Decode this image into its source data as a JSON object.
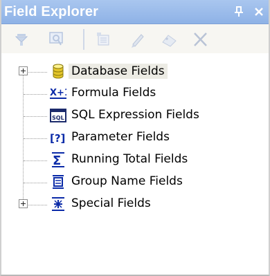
{
  "panel": {
    "title": "Field Explorer",
    "pin_glyph": "⊥",
    "close_glyph": "×"
  },
  "toolbar": {
    "items": [
      {
        "name": "insert-to-report-icon"
      },
      {
        "name": "browse-icon"
      },
      {
        "name": "new-icon"
      },
      {
        "name": "edit-icon"
      },
      {
        "name": "rename-icon"
      },
      {
        "name": "delete-icon"
      }
    ]
  },
  "tree": {
    "items": [
      {
        "label": "Database Fields",
        "icon": "database-icon",
        "expandable": true,
        "selected": true
      },
      {
        "label": "Formula Fields",
        "icon": "formula-icon",
        "icon_text": "X+1",
        "expandable": false
      },
      {
        "label": "SQL Expression Fields",
        "icon": "sql-icon",
        "icon_text": "SQL",
        "expandable": false
      },
      {
        "label": "Parameter Fields",
        "icon": "parameter-icon",
        "icon_text": "[?]",
        "expandable": false
      },
      {
        "label": "Running Total Fields",
        "icon": "sigma-icon",
        "icon_text": "Σ",
        "expandable": false
      },
      {
        "label": "Group Name Fields",
        "icon": "group-name-icon",
        "expandable": false
      },
      {
        "label": "Special Fields",
        "icon": "special-fields-icon",
        "expandable": true
      }
    ]
  },
  "colors": {
    "title_bg": "#a9c6ef",
    "toolbar_bg": "#f7f6f2",
    "selection_bg": "#ecebe4",
    "icon_blue": "#0a2aa8"
  }
}
